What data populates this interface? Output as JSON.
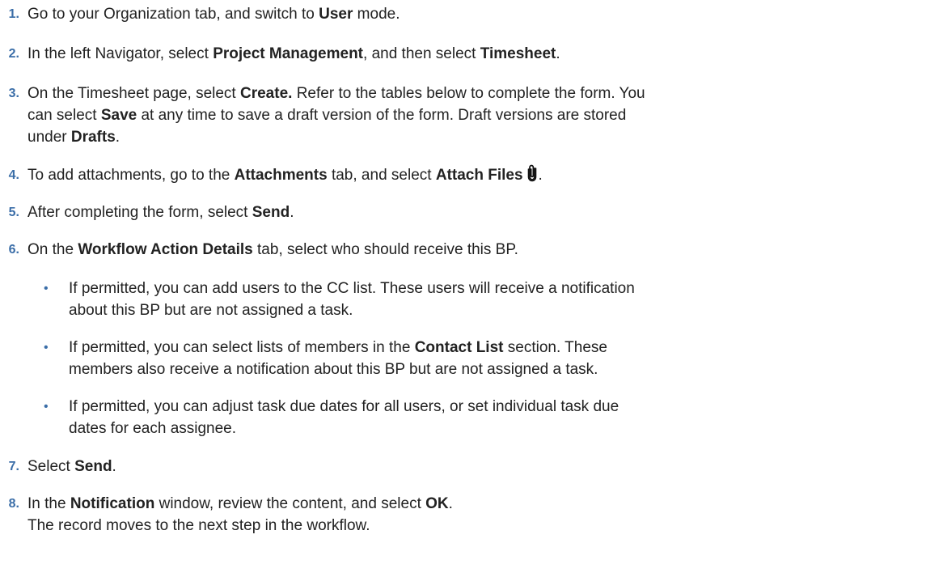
{
  "steps": [
    {
      "num": "1.",
      "parts": [
        "Go to your Organization tab, and switch to ",
        "User",
        " mode."
      ]
    },
    {
      "num": "2.",
      "parts": [
        "In the left Navigator, select ",
        "Project Management",
        ", and then select ",
        "Timesheet",
        "."
      ]
    },
    {
      "num": "3.",
      "lines": [
        [
          "On the Timesheet page, select ",
          "Create.",
          " Refer to the tables below to complete the form. You"
        ],
        [
          "can select ",
          "Save",
          " at any time to save a draft version of the form. Draft versions are stored"
        ],
        [
          "under ",
          "Drafts",
          "."
        ]
      ]
    },
    {
      "num": "4.",
      "parts": [
        "To add attachments, go to the ",
        "Attachments",
        " tab, and select ",
        "Attach Files",
        "",
        "."
      ],
      "icon": "paperclip-icon"
    },
    {
      "num": "5.",
      "parts": [
        "After completing the form, select ",
        "Send",
        "."
      ]
    },
    {
      "num": "6.",
      "parts": [
        "On the ",
        "Workflow Action Details",
        " tab, select who should receive this BP."
      ],
      "bullets": [
        {
          "bullet": "•",
          "lines": [
            "If permitted, you can add users to the CC list. These users will receive a notification",
            "about this BP but are not assigned a task."
          ]
        },
        {
          "bullet": "•",
          "lines": [
            [
              "If permitted, you can select lists of members in the ",
              "Contact List",
              " section. These"
            ],
            "members also receive a notification about this BP but are not assigned a task."
          ]
        },
        {
          "bullet": "•",
          "lines": [
            "If permitted, you can adjust task due dates for all users, or set individual task due",
            "dates for each assignee."
          ]
        }
      ]
    },
    {
      "num": "7.",
      "parts": [
        "Select ",
        "Send",
        "."
      ]
    },
    {
      "num": "8.",
      "lines": [
        [
          "In the ",
          "Notification",
          " window, review the content, and select ",
          "OK",
          "."
        ],
        [
          "The record moves to the next step in the workflow."
        ]
      ]
    }
  ]
}
